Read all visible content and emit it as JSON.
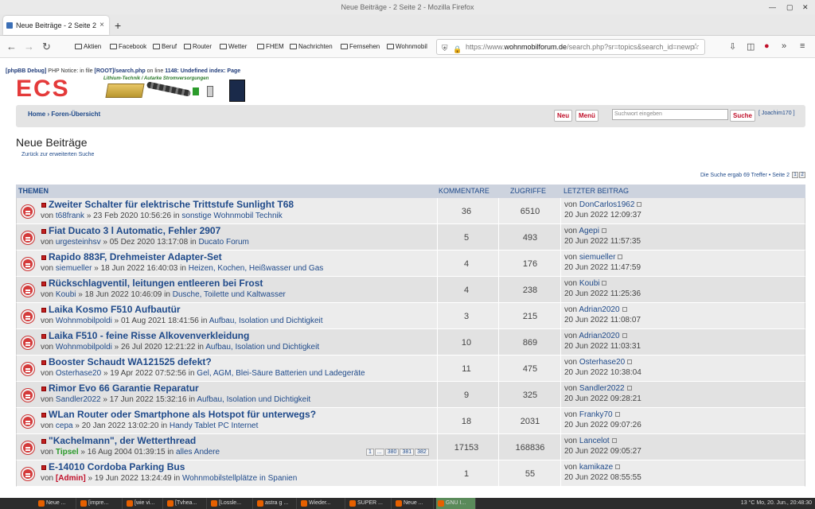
{
  "window": {
    "title": "Neue Beiträge - 2 Seite 2 - Mozilla Firefox"
  },
  "tab": {
    "label": "Neue Beiträge - 2 Seite 2",
    "close": "×",
    "new": "+"
  },
  "bookmarks": [
    "Aktien",
    "Facebook",
    "Beruf",
    "Router",
    "Wetter",
    "FHEM",
    "Nachrichten",
    "Fernsehen",
    "Wohnmobil"
  ],
  "url": {
    "prefix": "https://www.",
    "domain": "wohnmobilforum.de",
    "path": "/search.php?sr=topics&search_id=newp"
  },
  "nav": {
    "back": "←",
    "forward": "→",
    "reload": "↻"
  },
  "debug": {
    "tag": "[phpBB Debug]",
    "text": " PHP Notice: in file ",
    "file": "[ROOT]/search.php",
    "line_text": " on line ",
    "line": "1148",
    "msg": ": Undefined index: Page"
  },
  "banner": {
    "logo": "ECS",
    "tagline": "Lithium-Technik / Autarke Stromversorgungen"
  },
  "header": {
    "home": "Home",
    "sep": " › ",
    "forums": "Foren-Übersicht",
    "new_btn": "Neu",
    "menu_btn": "Menü",
    "search_placeholder": "Suchwort eingeben",
    "search_btn": "Suche",
    "user": "[ Joachim170 ]"
  },
  "page": {
    "title": "Neue Beiträge",
    "back_link": "Zurück zur erweiterten Suche",
    "result": "Die Suche ergab 69 Treffer",
    "page_link": "Seite 2",
    "page_nums": [
      "1",
      "2"
    ]
  },
  "table": {
    "headers": {
      "topics": "THEMEN",
      "comments": "KOMMENTARE",
      "views": "ZUGRIFFE",
      "last": "LETZTER BEITRAG"
    },
    "rows": [
      {
        "title": "Zweiter Schalter für elektrische Trittstufe Sunlight T68",
        "author": "t68frank",
        "date": "23 Feb 2020 10:56:26",
        "forum": "sonstige Wohnmobil Technik",
        "comments": "36",
        "views": "6510",
        "last_by": "DonCarlos1962",
        "last_date": "20 Jun 2022 12:09:37"
      },
      {
        "title": "Fiat Ducato 3 l Automatic, Fehler 2907",
        "author": "urgesteinhsv",
        "date": "05 Dez 2020 13:17:08",
        "forum": "Ducato Forum",
        "comments": "5",
        "views": "493",
        "last_by": "Agepi",
        "last_date": "20 Jun 2022 11:57:35"
      },
      {
        "title": "Rapido 883F, Drehmeister Adapter-Set",
        "author": "siemueller",
        "date": "18 Jun 2022 16:40:03",
        "forum": "Heizen, Kochen, Heißwasser und Gas",
        "comments": "4",
        "views": "176",
        "last_by": "siemueller",
        "last_date": "20 Jun 2022 11:47:59"
      },
      {
        "title": "Rückschlagventil, leitungen entleeren bei Frost",
        "author": "Koubi",
        "date": "18 Jun 2022 10:46:09",
        "forum": "Dusche, Toilette und Kaltwasser",
        "comments": "4",
        "views": "238",
        "last_by": "Koubi",
        "last_date": "20 Jun 2022 11:25:36"
      },
      {
        "title": "Laika Kosmo F510 Aufbautür",
        "author": "Wohnmobilpoldi",
        "date": "01 Aug 2021 18:41:56",
        "forum": "Aufbau, Isolation und Dichtigkeit",
        "comments": "3",
        "views": "215",
        "last_by": "Adrian2020",
        "last_date": "20 Jun 2022 11:08:07"
      },
      {
        "title": "Laika F510 - feine Risse Alkovenverkleidung",
        "author": "Wohnmobilpoldi",
        "date": "26 Jul 2020 12:21:22",
        "forum": "Aufbau, Isolation und Dichtigkeit",
        "comments": "10",
        "views": "869",
        "last_by": "Adrian2020",
        "last_date": "20 Jun 2022 11:03:31"
      },
      {
        "title": "Booster Schaudt WA121525 defekt?",
        "author": "Osterhase20",
        "date": "19 Apr 2022 07:52:56",
        "forum": "Gel, AGM, Blei-Säure Batterien und Ladegeräte",
        "comments": "11",
        "views": "475",
        "last_by": "Osterhase20",
        "last_date": "20 Jun 2022 10:38:04"
      },
      {
        "title": "Rimor Evo 66 Garantie Reparatur",
        "author": "Sandler2022",
        "date": "17 Jun 2022 15:32:16",
        "forum": "Aufbau, Isolation und Dichtigkeit",
        "comments": "9",
        "views": "325",
        "last_by": "Sandler2022",
        "last_date": "20 Jun 2022 09:28:21"
      },
      {
        "title": "WLan Router oder Smartphone als Hotspot für unterwegs?",
        "author": "cepa",
        "date": "20 Jan 2022 13:02:20",
        "forum": "Handy Tablet PC Internet",
        "comments": "18",
        "views": "2031",
        "last_by": "Franky70",
        "last_date": "20 Jun 2022 09:07:26"
      },
      {
        "title": "\"Kachelmann\", der Wetterthread",
        "author": "Tipsel",
        "date": "16 Aug 2004 01:39:15",
        "forum": "alles Andere",
        "comments": "17153",
        "views": "168836",
        "last_by": "Lancelot",
        "last_date": "20 Jun 2022 09:05:27",
        "pages": [
          "1",
          "...",
          "380",
          "381",
          "382"
        ]
      },
      {
        "title": "E-14010 Cordoba Parking Bus",
        "author": "[Admin]",
        "date": "19 Jun 2022 13:24:49",
        "forum": "Wohnmobilstellplätze in Spanien",
        "comments": "1",
        "views": "55",
        "last_by": "kamikaze",
        "last_date": "20 Jun 2022 08:55:55"
      }
    ],
    "word_von": "von",
    "word_in": "in",
    "word_raquo": "»"
  },
  "taskbar": {
    "items": [
      "Neue ...",
      "[impre...",
      "[wie vi...",
      "[Tvhea...",
      "[Lossle...",
      "astra g ...",
      "Wieder...",
      "SUPER ...",
      "Neue ...",
      "GNU I..."
    ],
    "tray": "13 °C   Mo, 20. Jun., 20:48:30"
  },
  "colors": {
    "link": "#1f4a8a",
    "accent": "#c0102a",
    "header": "#cdd3de"
  }
}
